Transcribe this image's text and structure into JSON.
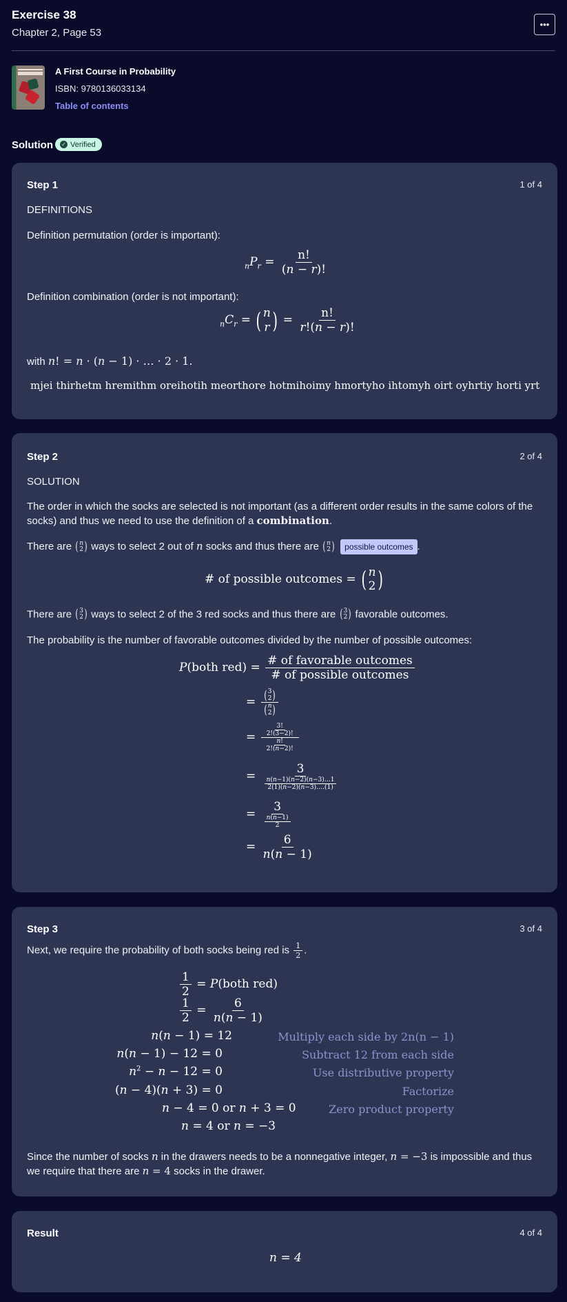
{
  "header": {
    "title": "Exercise 38",
    "subtitle": "Chapter 2, Page 53",
    "more_label": "•••"
  },
  "book": {
    "title": "A First Course in Probability",
    "isbn": "ISBN: 9780136033134",
    "toc_label": "Table of contents",
    "cover_text": "A FIRST COURSE IN PROBABILITY"
  },
  "solution": {
    "label": "Solution",
    "badge": "Verified"
  },
  "steps": [
    {
      "title": "Step 1",
      "count": "1 of 4",
      "heading": "DEFINITIONS",
      "perm_label": "Definition permutation (order is important):",
      "comb_label": "Definition combination (order is not important):",
      "with_text": "with",
      "gibberish": "mjei thirhetm hremithm oreihotih meorthore hotmihoimy hmortyho ihtomyh oirt oyhrtiy horti yrt"
    },
    {
      "title": "Step 2",
      "count": "2 of 4",
      "heading": "SOLUTION",
      "p1_a": "The order in which the socks are selected is not important (as a different order results in the same colors of the socks) and thus we need to use the definition of a ",
      "p1_b": "combination",
      "p1_c": ".",
      "p2_a": "There are",
      "p2_b": "ways to select 2 out of",
      "p2_c": "socks and thus there are",
      "p2_tag": "possible outcomes",
      "p2_d": ".",
      "eq1_lhs": "# of possible outcomes",
      "p3_a": "There are",
      "p3_b": "ways to select 2 of the 3 red socks and thus there are",
      "p3_c": "favorable outcomes.",
      "p4": "The probability is the number of favorable outcomes divided by the number of possible outcomes:",
      "prob_lhs": "both red",
      "frac_num": "# of favorable outcomes",
      "frac_den": "# of possible outcomes"
    },
    {
      "title": "Step 3",
      "count": "3 of 4",
      "intro": "Next, we require the probability of both socks being red is",
      "note1": "Multiply each side by 2n(n − 1)",
      "note2": "Subtract 12 from each side",
      "note3": "Use distributive property",
      "note4": "Factorize",
      "note5": "Zero product property",
      "or_text": "or",
      "conclusion_a": "Since the number of socks",
      "conclusion_b": "in the drawers needs to be a nonnegative integer,",
      "conclusion_c": "is impossible and thus we require that there are",
      "conclusion_d": "socks in the drawer."
    },
    {
      "title": "Result",
      "count": "4 of 4",
      "answer": "n = 4"
    }
  ],
  "colors": {
    "background": "#0a0a2a",
    "card": "#2d3553",
    "accent": "#8b8ff5",
    "badge": "#c7f5e6",
    "note": "#8b93cf"
  }
}
